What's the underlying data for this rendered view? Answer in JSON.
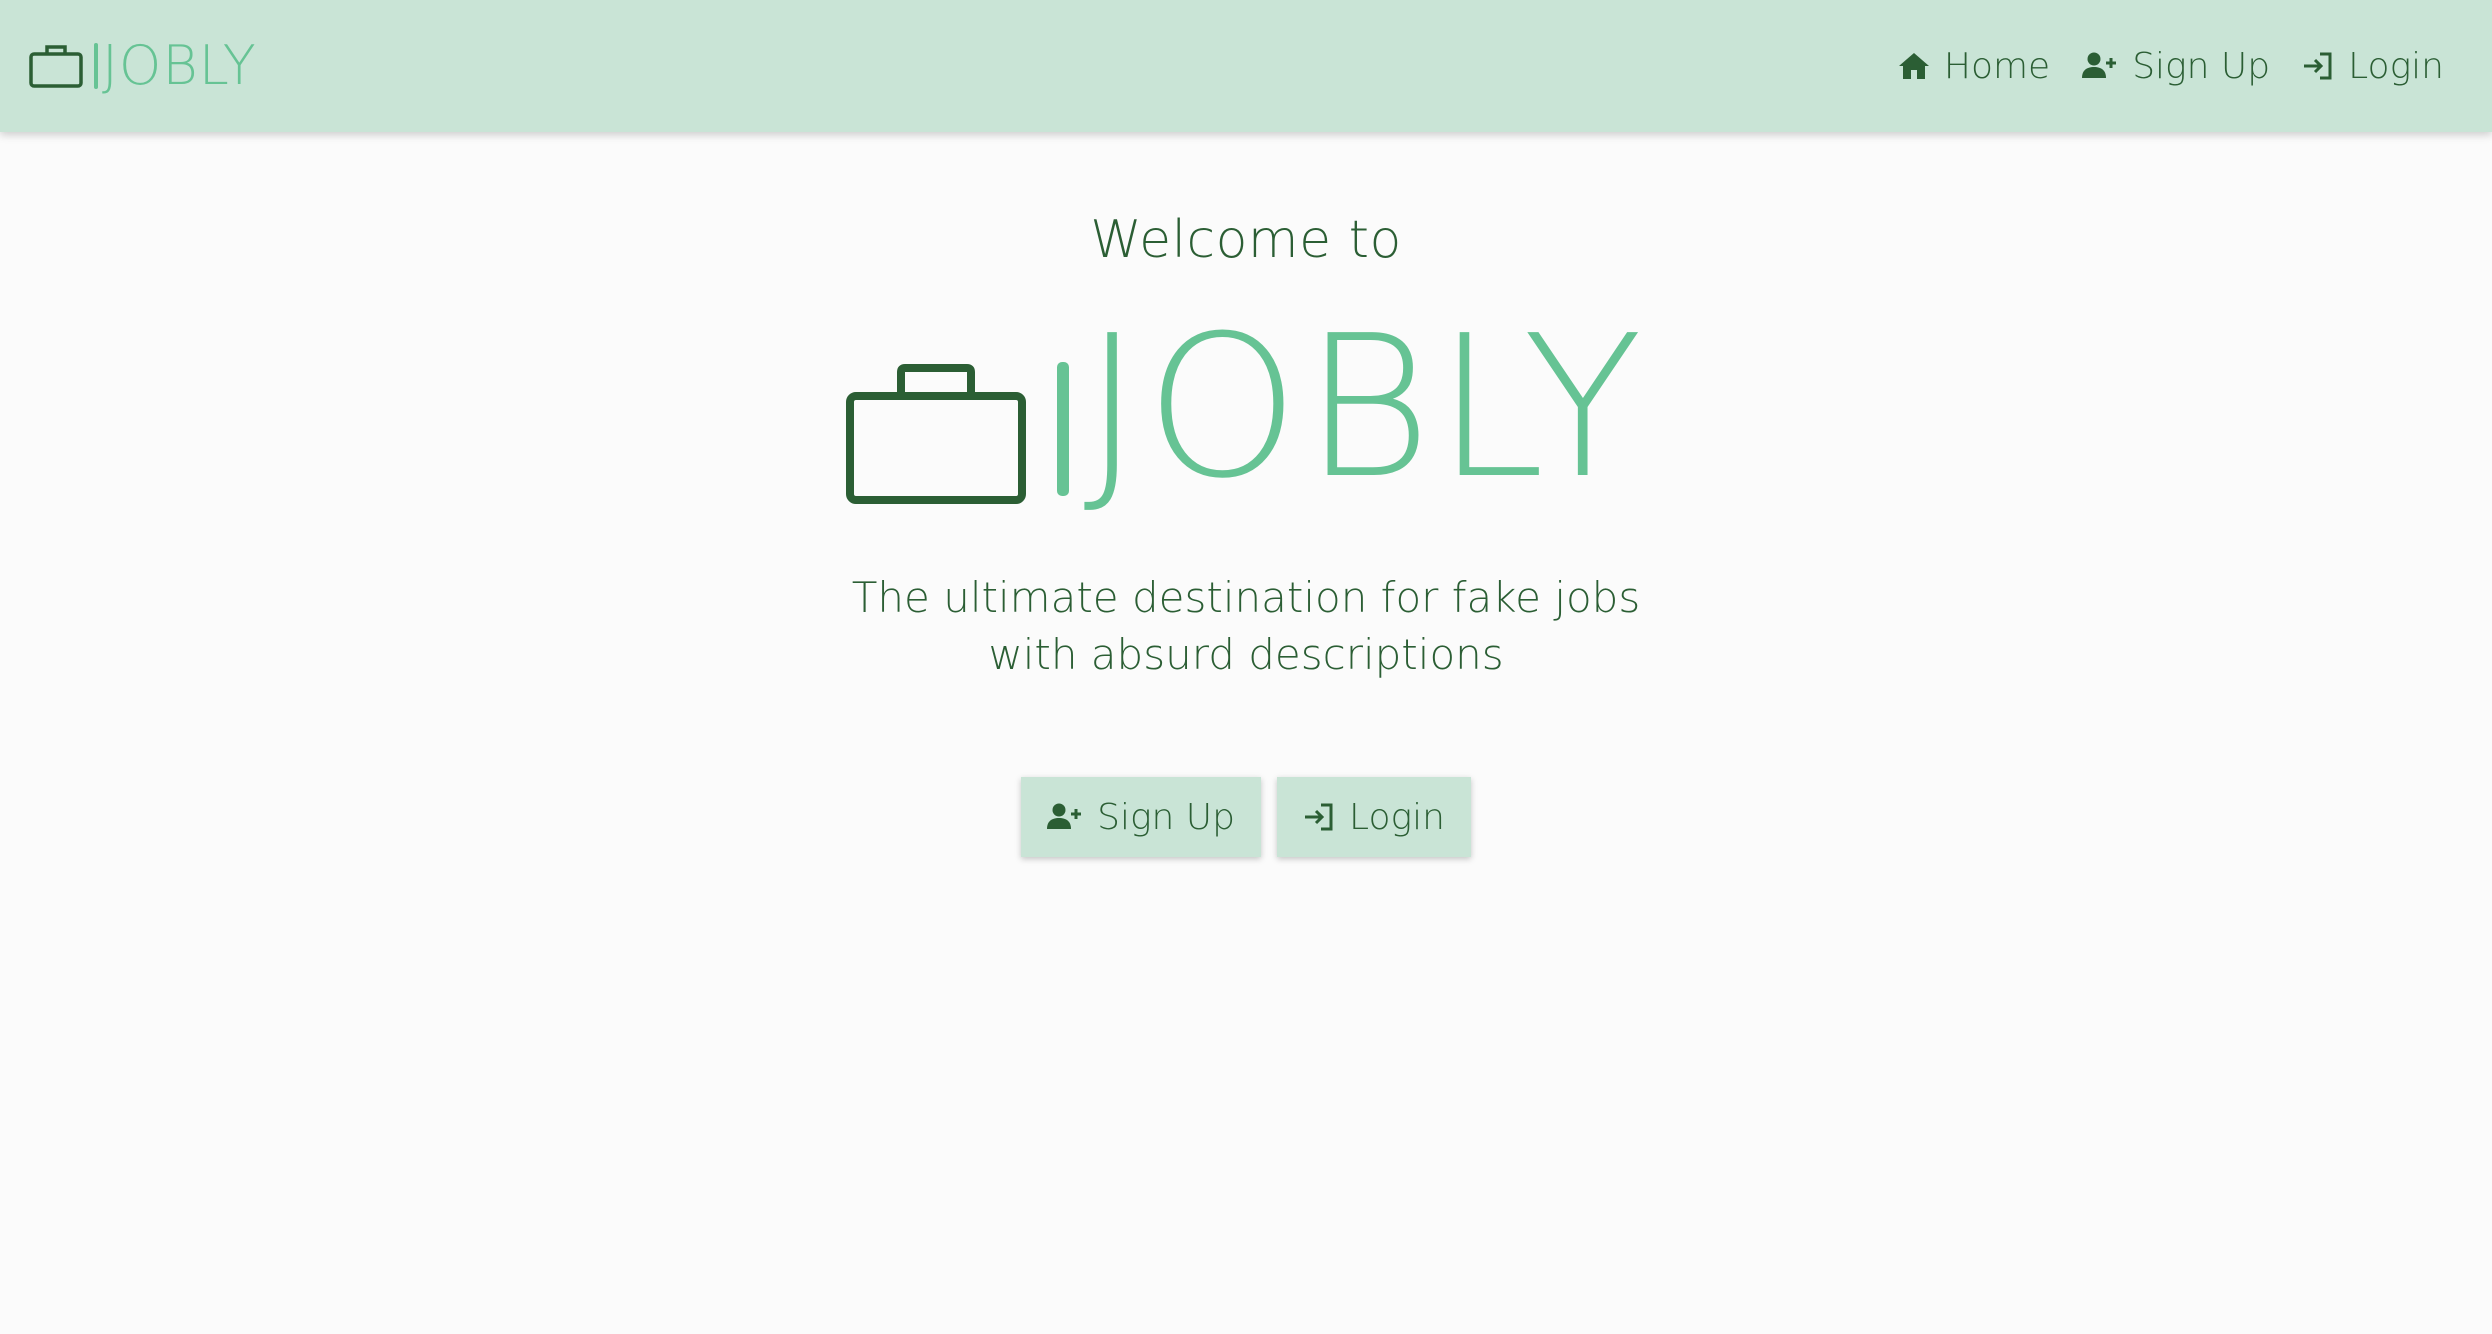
{
  "brand": {
    "name": "JOBLY",
    "icon": "briefcase-icon"
  },
  "nav": {
    "items": [
      {
        "label": "Home",
        "icon": "home-icon"
      },
      {
        "label": "Sign Up",
        "icon": "user-plus-icon"
      },
      {
        "label": "Login",
        "icon": "login-icon"
      }
    ]
  },
  "hero": {
    "welcome": "Welcome to",
    "title": "JOBLY",
    "tagline": "The ultimate destination for fake jobs with absurd descriptions"
  },
  "actions": {
    "signup_label": "Sign Up",
    "login_label": "Login"
  },
  "colors": {
    "navbar_bg": "#c9e4d6",
    "brand_green": "#66c394",
    "text_green": "#2b5e34",
    "page_bg": "#fbfbfb"
  }
}
